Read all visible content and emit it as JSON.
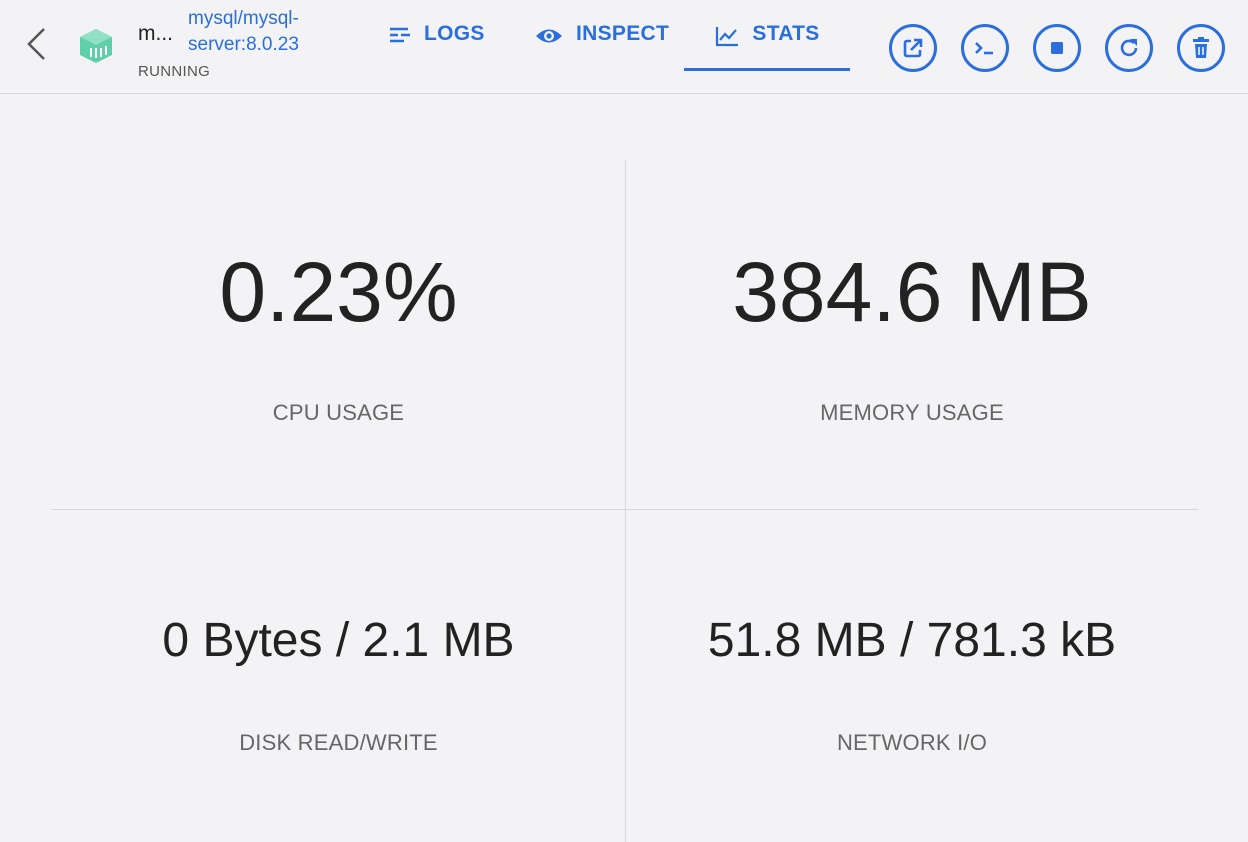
{
  "header": {
    "container_name": "m...",
    "image": "mysql/mysql-server:8.0.23",
    "status": "RUNNING",
    "colors": {
      "accent": "#2a6fdb",
      "container_icon": "#5fcfa9"
    },
    "tabs": [
      {
        "label": "LOGS",
        "icon": "logs-icon",
        "active": false
      },
      {
        "label": "INSPECT",
        "icon": "eye-icon",
        "active": true
      },
      {
        "label": "STATS",
        "icon": "chart-line-icon",
        "active": true
      }
    ],
    "actions": [
      {
        "name": "open-in-browser",
        "icon": "external-link-icon"
      },
      {
        "name": "cli",
        "icon": "terminal-icon"
      },
      {
        "name": "stop",
        "icon": "stop-icon"
      },
      {
        "name": "restart",
        "icon": "restart-icon"
      },
      {
        "name": "delete",
        "icon": "trash-icon"
      }
    ]
  },
  "stats": {
    "cpu": {
      "value": "0.23%",
      "label": "CPU USAGE"
    },
    "memory": {
      "value": "384.6 MB",
      "label": "MEMORY USAGE"
    },
    "disk": {
      "value": "0 Bytes / 2.1 MB",
      "label": "DISK READ/WRITE"
    },
    "network": {
      "value": "51.8 MB / 781.3 kB",
      "label": "NETWORK I/O"
    }
  }
}
